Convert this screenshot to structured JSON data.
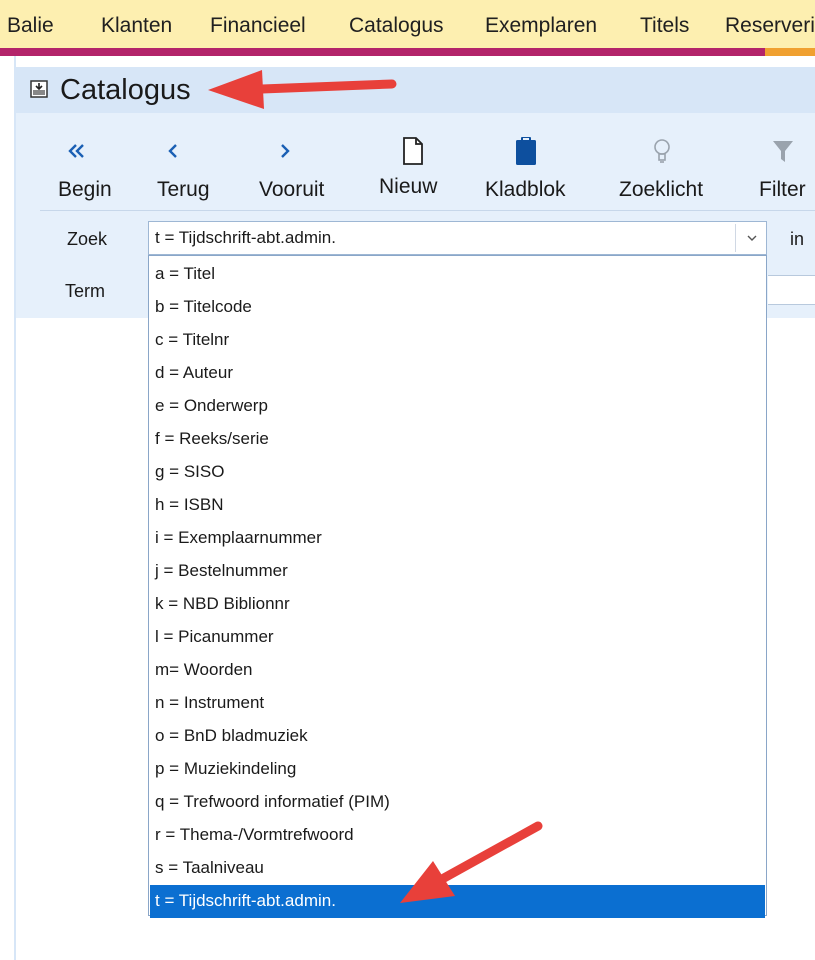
{
  "menubar": {
    "items": [
      "Balie",
      "Klanten",
      "Financieel",
      "Catalogus",
      "Exemplaren",
      "Titels",
      "Reserveri"
    ]
  },
  "window": {
    "title": "Catalogus",
    "title_icon": "window-icon"
  },
  "toolbar": {
    "buttons": [
      {
        "label": "Begin",
        "icon": "double-chevron-left-icon"
      },
      {
        "label": "Terug",
        "icon": "chevron-left-icon"
      },
      {
        "label": "Vooruit",
        "icon": "chevron-right-icon"
      },
      {
        "label": "Nieuw",
        "icon": "new-document-icon"
      },
      {
        "label": "Kladblok",
        "icon": "clipboard-icon"
      },
      {
        "label": "Zoeklicht",
        "icon": "lightbulb-icon"
      },
      {
        "label": "Filter",
        "icon": "filter-icon"
      }
    ]
  },
  "search": {
    "zoek_label": "Zoek",
    "term_label": "Term",
    "in_label": "in",
    "selected_value": "t = Tijdschrift-abt.admin."
  },
  "dropdown": {
    "options": [
      "a = Titel",
      "b = Titelcode",
      "c = Titelnr",
      "d = Auteur",
      "e = Onderwerp",
      "f  = Reeks/serie",
      "g = SISO",
      "h = ISBN",
      "i  = Exemplaarnummer",
      "j  = Bestelnummer",
      "k = NBD Biblionnr",
      "l  = Picanummer",
      "m= Woorden",
      "n = Instrument",
      "o = BnD bladmuziek",
      "p = Muziekindeling",
      "q = Trefwoord informatief (PIM)",
      "r = Thema-/Vormtrefwoord",
      "s = Taalniveau",
      "t = Tijdschrift-abt.admin."
    ],
    "selected_index": 19
  },
  "colors": {
    "menubar_bg": "#fdefb0",
    "accent_stripe": "#b3246a",
    "selection": "#0b6fd1",
    "annotation_arrow": "#e8403a",
    "toolbar_bg": "#e6f0fb",
    "icon_blue": "#1a5fb4"
  }
}
